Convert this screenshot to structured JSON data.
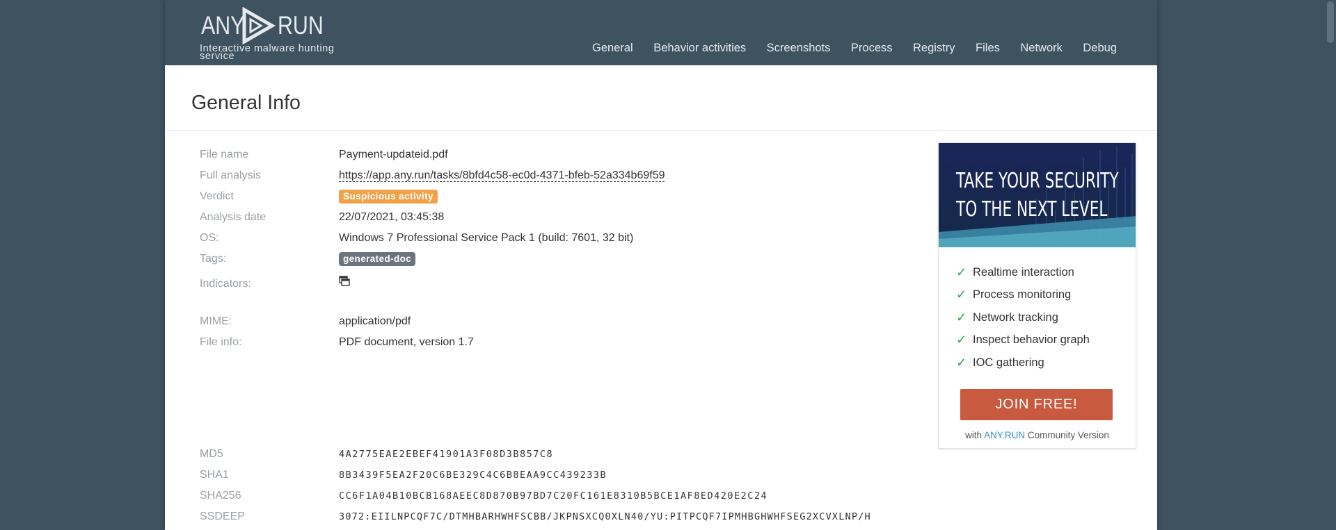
{
  "brand": {
    "logo_left": "ANY",
    "logo_right": "RUN",
    "tagline": "Interactive malware hunting service"
  },
  "nav": [
    "General",
    "Behavior activities",
    "Screenshots",
    "Process",
    "Registry",
    "Files",
    "Network",
    "Debug"
  ],
  "page_title": "General Info",
  "info": {
    "file_name": {
      "label": "File name",
      "value": "Payment-updateid.pdf"
    },
    "full_analysis": {
      "label": "Full analysis",
      "value": "https://app.any.run/tasks/8bfd4c58-ec0d-4371-bfeb-52a334b69f59"
    },
    "verdict": {
      "label": "Verdict",
      "value": "Suspicious activity"
    },
    "analysis_date": {
      "label": "Analysis date",
      "value": "22/07/2021, 03:45:38"
    },
    "os": {
      "label": "OS:",
      "value": "Windows 7 Professional Service Pack 1 (build: 7601, 32 bit)"
    },
    "tags": {
      "label": "Tags:",
      "value": "generated-doc"
    },
    "indicators": {
      "label": "Indicators:"
    },
    "mime": {
      "label": "MIME:",
      "value": "application/pdf"
    },
    "file_info": {
      "label": "File info:",
      "value": "PDF document, version 1.7"
    },
    "md5": {
      "label": "MD5",
      "value": "4A2775EAE2EBEF41901A3F08D3B857C8"
    },
    "sha1": {
      "label": "SHA1",
      "value": "8B3439F5EA2F20C6BE329C4C6B8EAA9CC439233B"
    },
    "sha256": {
      "label": "SHA256",
      "value": "CC6F1A04B10BCB168AEEC8D870B97BD7C20FC161E8310B5BCE1AF8ED420E2C24"
    },
    "ssdeep": {
      "label": "SSDEEP",
      "value": "3072:EIILNPCQF7C/DTMHBARHWHFSCBB/JKPNSXCQ0XLN40/YU:PITPCQF7IPMHBGHWHFSEG2XCVXLNP/H"
    }
  },
  "promo": {
    "title_line1": "TAKE YOUR SECURITY",
    "title_line2": "TO THE NEXT LEVEL",
    "features": [
      "Realtime interaction",
      "Process monitoring",
      "Network tracking",
      "Inspect behavior graph",
      "IOC gathering"
    ],
    "join_label": "JOIN FREE!",
    "with_prefix": "with",
    "with_brand": "ANY.RUN",
    "with_suffix": "Community Version"
  },
  "colors": {
    "topbar": "#3f5260",
    "verdict_badge": "#f0a14a",
    "tag_badge": "#6c757d",
    "join_button": "#c85a3f",
    "check": "#2fa84f",
    "link_brand": "#3a8fd6"
  },
  "icons": {
    "logo": "play-triangle-icon",
    "indicators": "windows-stack-icon",
    "feature_bullet": "checkmark-icon"
  }
}
